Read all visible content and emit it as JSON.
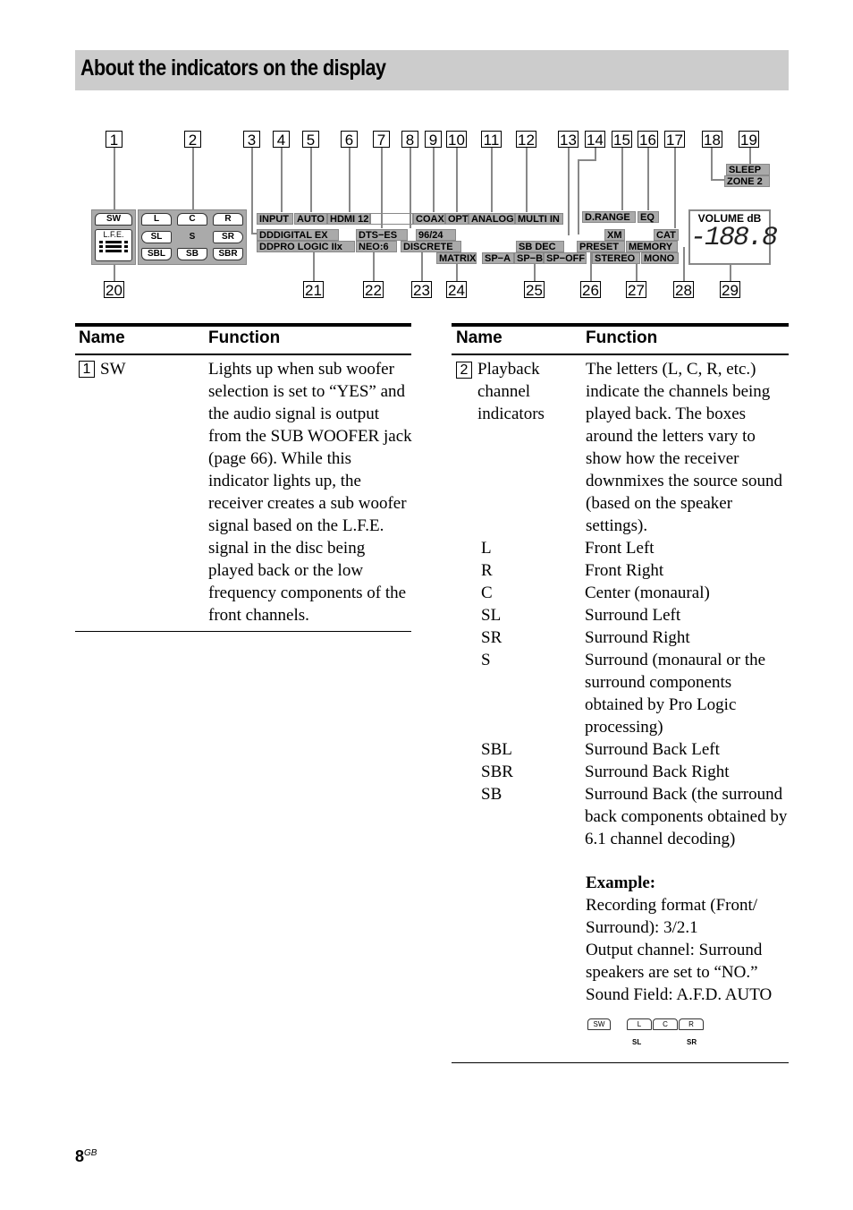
{
  "page": {
    "title": "About the indicators on the display",
    "footer": {
      "page_number": "8",
      "suffix": "GB"
    }
  },
  "diagram": {
    "callouts_top": [
      "1",
      "2",
      "3",
      "4",
      "5",
      "6",
      "7",
      "8",
      "9",
      "10",
      "11",
      "12",
      "13",
      "14",
      "15",
      "16",
      "17",
      "18",
      "19"
    ],
    "callouts_bottom": [
      "20",
      "21",
      "22",
      "23",
      "24",
      "25",
      "26",
      "27",
      "28",
      "29"
    ],
    "indicators": {
      "sw": "SW",
      "lfe": "L.F.E.",
      "channels": [
        "L",
        "C",
        "R",
        "SL",
        "S",
        "SR",
        "SBL",
        "SB",
        "SBR"
      ],
      "input": "INPUT",
      "auto": "AUTO",
      "hdmi": "HDMI 12",
      "coax": "COAX",
      "opt": "OPT",
      "analog": "ANALOG",
      "multi_in": "MULTI IN",
      "digital_ex": "DDDIGITAL EX",
      "pro_logic": "DDPRO LOGIC IIx",
      "dts_es": "DTS−ES",
      "neo6": "NEO:6",
      "rate": "96/24",
      "discrete": "DISCRETE",
      "matrix": "MATRIX",
      "sb_dec": "SB DEC",
      "sp_a": "SP−A",
      "sp_b": "SP−B",
      "sp_off": "SP−OFF",
      "d_range": "D.RANGE",
      "eq": "EQ",
      "xm": "XM",
      "cat": "CAT",
      "preset": "PRESET",
      "memory": "MEMORY",
      "stereo": "STEREO",
      "mono": "MONO",
      "sleep": "SLEEP",
      "zone2": "ZONE 2",
      "volume_label": "VOLUME dB",
      "volume_value": "-188.8"
    }
  },
  "left_table": {
    "headers": {
      "name": "Name",
      "function": "Function"
    },
    "rows": [
      {
        "num": "1",
        "name": "SW",
        "function": "Lights up when sub woofer selection is set to “YES” and the audio signal is output from the SUB WOOFER jack (page 66). While this indicator lights up, the receiver creates a sub woofer signal based on the L.F.E. signal in the disc being played back or the low frequency components of the front channels."
      }
    ]
  },
  "right_table": {
    "headers": {
      "name": "Name",
      "function": "Function"
    },
    "row": {
      "num": "2",
      "name": "Playback channel indicators",
      "function": "The letters (L, C, R, etc.) indicate the channels being played back. The boxes around the letters vary to show how the receiver downmixes the source sound (based on the speaker settings).",
      "channels": [
        {
          "code": "L",
          "desc": "Front Left"
        },
        {
          "code": "R",
          "desc": "Front Right"
        },
        {
          "code": "C",
          "desc": "Center (monaural)"
        },
        {
          "code": "SL",
          "desc": "Surround Left"
        },
        {
          "code": "SR",
          "desc": "Surround Right"
        },
        {
          "code": "S",
          "desc": "Surround (monaural or the surround components obtained by Pro Logic processing)"
        },
        {
          "code": "SBL",
          "desc": "Surround Back Left"
        },
        {
          "code": "SBR",
          "desc": "Surround Back Right"
        },
        {
          "code": "SB",
          "desc": "Surround Back (the surround back components obtained by 6.1 channel decoding)"
        }
      ],
      "example": {
        "label": "Example:",
        "recording_format": "Recording format (Front/ Surround): 3/2.1",
        "output_channel": "Output channel: Surround speakers are set to “NO.”",
        "sound_field": "Sound Field: A.F.D. AUTO",
        "icons": [
          "SW",
          "L",
          "C",
          "R"
        ],
        "icon_labels": [
          "SL",
          "SR"
        ]
      }
    }
  }
}
